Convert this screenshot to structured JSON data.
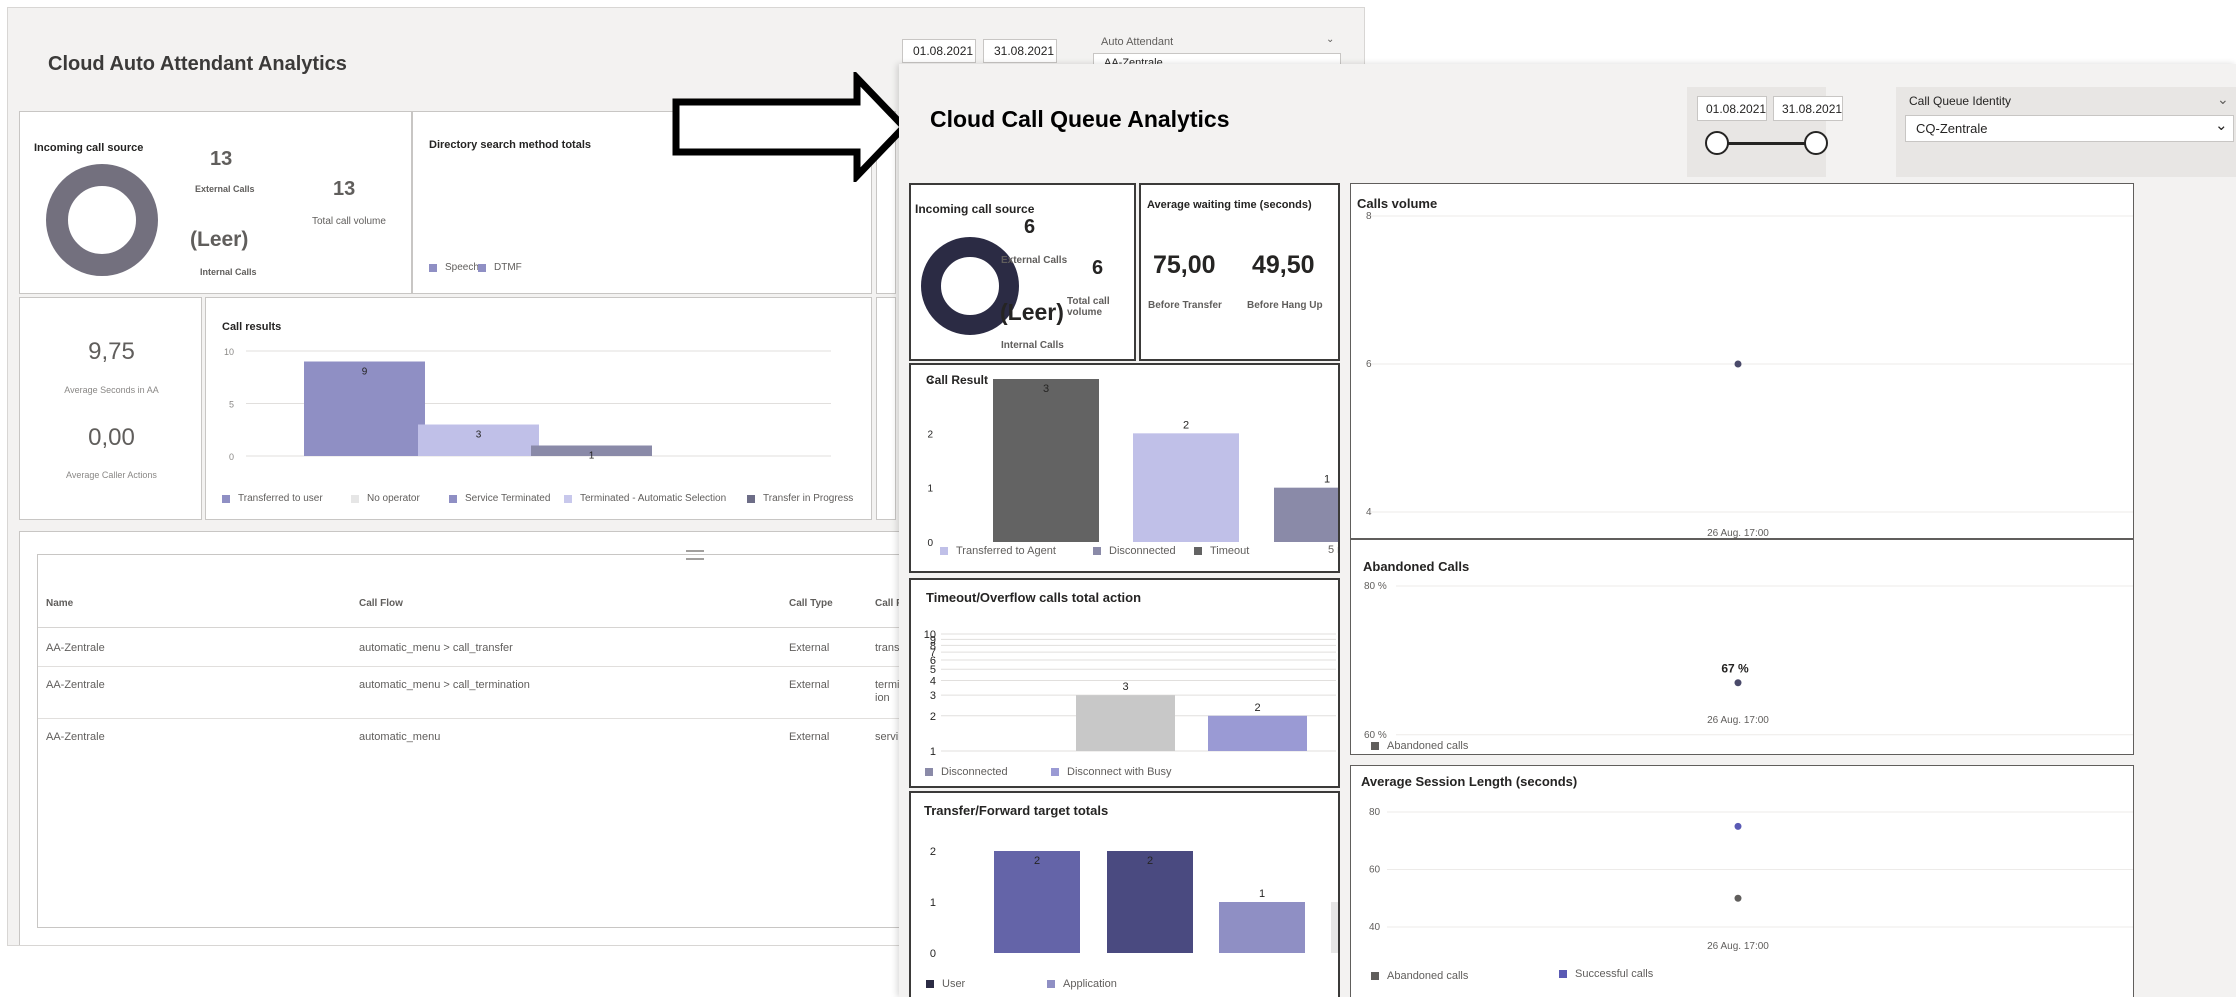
{
  "aa": {
    "title": "Cloud Auto Attendant Analytics",
    "date_from": "01.08.2021",
    "date_to": "31.08.2021",
    "filter_label": "Auto Attendant",
    "filter_value": "AA-Zentrale",
    "incoming": {
      "title": "Incoming call source",
      "external_value": "13",
      "external_label": "External Calls",
      "total_value": "13",
      "total_label": "Total call volume",
      "internal_value": "(Leer)",
      "internal_label": "Internal Calls"
    },
    "directory": {
      "title": "Directory search method totals",
      "legend": [
        "Speech",
        "DTMF"
      ]
    },
    "avg": {
      "seconds_value": "9,75",
      "seconds_label": "Average Seconds in AA",
      "actions_value": "0,00",
      "actions_label": "Average Caller Actions"
    },
    "call_results": {
      "title": "Call results",
      "legend": [
        "Transferred to user",
        "No operator",
        "Service Terminated",
        "Terminated - Automatic Selection",
        "Transfer in Progress"
      ]
    },
    "table": {
      "columns": [
        "Name",
        "Call Flow",
        "Call Type",
        "Call R"
      ],
      "rows": [
        {
          "name": "AA-Zentrale",
          "flow": "automatic_menu > call_transfer",
          "type": "External",
          "result": "trans"
        },
        {
          "name": "AA-Zentrale",
          "flow": "automatic_menu > call_termination",
          "type": "External",
          "result": "termi ion"
        },
        {
          "name": "AA-Zentrale",
          "flow": "automatic_menu",
          "type": "External",
          "result": "servi"
        }
      ]
    }
  },
  "cq": {
    "title": "Cloud Call Queue Analytics",
    "date_from": "01.08.2021",
    "date_to": "31.08.2021",
    "filter_label": "Call Queue Identity",
    "filter_value": "CQ-Zentrale",
    "incoming": {
      "title": "Incoming call source",
      "external_value": "6",
      "external_label": "External Calls",
      "total_value": "6",
      "total_label": "Total call volume",
      "internal_value": "(Leer)",
      "internal_label": "Internal Calls"
    },
    "waiting": {
      "title": "Average waiting time (seconds)",
      "before_transfer_value": "75,00",
      "before_transfer_label": "Before Transfer",
      "before_hangup_value": "49,50",
      "before_hangup_label": "Before Hang Up"
    },
    "call_result": {
      "title": "Call Result",
      "legend": [
        "Transferred to Agent",
        "Disconnected",
        "Timeout",
        "5 more"
      ]
    },
    "timeout": {
      "title": "Timeout/Overflow calls total action",
      "legend": [
        "Disconnected",
        "Disconnect with Busy"
      ]
    },
    "transfer": {
      "title": "Transfer/Forward target totals",
      "legend": [
        "User",
        "Application"
      ]
    },
    "calls_volume": {
      "title": "Calls volume"
    },
    "abandoned": {
      "title": "Abandoned Calls",
      "legend": [
        "Abandoned calls"
      ]
    },
    "session": {
      "title": "Average Session Length (seconds)",
      "legend": [
        "Abandoned calls",
        "Successful calls"
      ]
    }
  },
  "colors": {
    "accent_purple": "#8f8fc4",
    "light_purple": "#c0c0e8",
    "dark_navy": "#2b2b44",
    "dark_gray": "#636363",
    "slate": "#8a8aa8",
    "indigo": "#6464a8",
    "deep_indigo": "#4a4a80"
  },
  "chart_data": [
    {
      "type": "bar",
      "title": "Call results",
      "categories": [
        "Transferred to user",
        "Service Terminated",
        "Transfer in Progress"
      ],
      "values": [
        9,
        3,
        1
      ],
      "ylim": [
        0,
        10
      ],
      "yticks": [
        0,
        5,
        10
      ]
    },
    {
      "type": "bar",
      "title": "Call Result",
      "categories": [
        "Timeout",
        "Transferred to Agent",
        "Disconnected"
      ],
      "values": [
        3,
        2,
        1
      ],
      "ylim": [
        0,
        3
      ],
      "yticks": [
        0,
        1,
        2,
        3
      ]
    },
    {
      "type": "bar",
      "title": "Timeout/Overflow calls total action",
      "categories": [
        "Disconnected",
        "Disconnect with Busy"
      ],
      "values": [
        3,
        2
      ],
      "ylim": [
        1,
        10
      ],
      "yticks": [
        1,
        2,
        3,
        4,
        5,
        6,
        7,
        8,
        9,
        10
      ]
    },
    {
      "type": "bar",
      "title": "Transfer/Forward target totals",
      "categories": [
        "User",
        "User",
        "Application",
        "Application"
      ],
      "values": [
        2,
        2,
        1,
        1
      ],
      "ylim": [
        0,
        2
      ],
      "yticks": [
        0,
        1,
        2
      ]
    },
    {
      "type": "scatter",
      "title": "Calls volume",
      "x": [
        "26 Aug. 17:00"
      ],
      "values": [
        6
      ],
      "ylim": [
        4,
        8
      ],
      "yticks": [
        4,
        6,
        8
      ]
    },
    {
      "type": "scatter",
      "title": "Abandoned Calls",
      "x": [
        "26 Aug. 17:00"
      ],
      "values": [
        67
      ],
      "data_labels": [
        "67 %"
      ],
      "ylim": [
        55,
        80
      ],
      "yticks": [
        "60 %",
        "80 %"
      ]
    },
    {
      "type": "scatter",
      "title": "Average Session Length (seconds)",
      "x": [
        "26 Aug. 17:00"
      ],
      "series": [
        {
          "name": "Abandoned calls",
          "values": [
            50
          ]
        },
        {
          "name": "Successful calls",
          "values": [
            75
          ]
        }
      ],
      "ylim": [
        40,
        80
      ],
      "yticks": [
        40,
        60,
        80
      ]
    }
  ]
}
